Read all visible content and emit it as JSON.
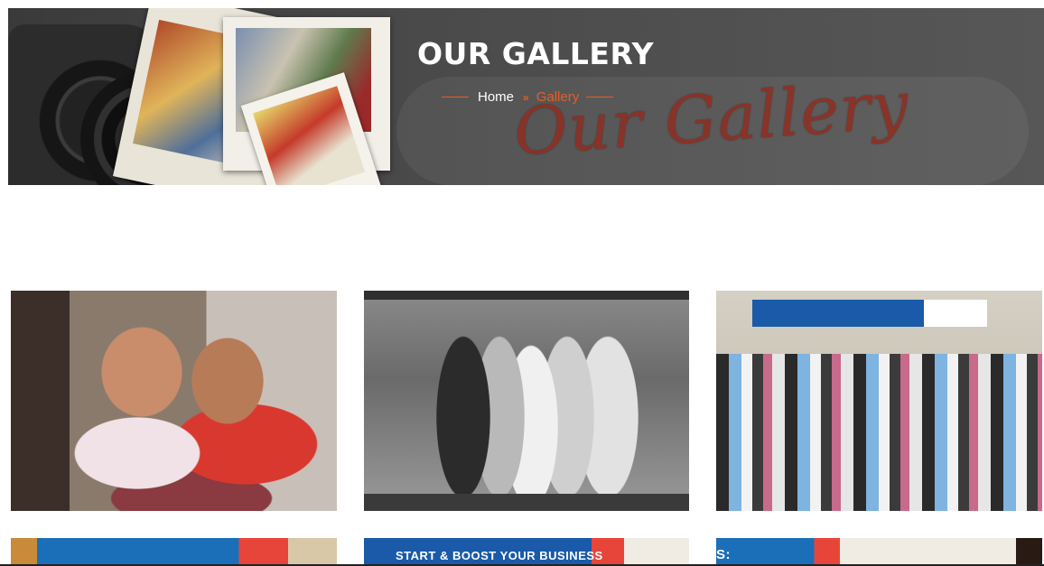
{
  "banner": {
    "title": "OUR GALLERY",
    "script_text": "Our Gallery",
    "accent_color": "#e85d22"
  },
  "breadcrumb": {
    "home": "Home",
    "separator": "»",
    "current": "Gallery"
  },
  "gallery": {
    "items": [
      {
        "alt": "two-girls-photo"
      },
      {
        "alt": "newspaper-award-photo"
      },
      {
        "alt": "group-photo"
      },
      {
        "alt": "banner-photo-1"
      },
      {
        "alt": "banner-photo-2",
        "text": "START & BOOST YOUR BUSINESS"
      },
      {
        "alt": "banner-photo-3",
        "text": "S:"
      }
    ]
  }
}
